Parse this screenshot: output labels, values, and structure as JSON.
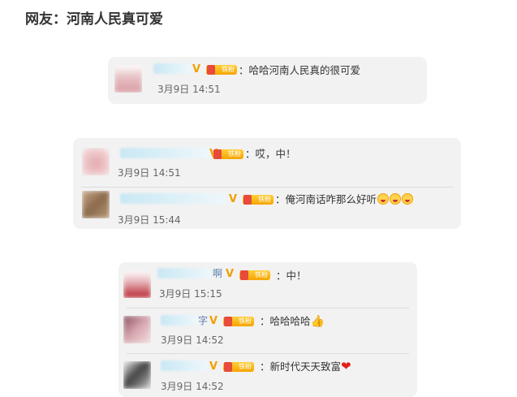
{
  "headline": "网友：河南人民真可爱",
  "badges": {
    "v": "V",
    "fan": "铁粉"
  },
  "cards": [
    {
      "comments": [
        {
          "text": "：哈哈河南人民真的很可爱",
          "time": "3月9日 14:51",
          "avatar_color": "#d9a8ad"
        }
      ]
    },
    {
      "comments": [
        {
          "text": "：哎，中！",
          "time": "3月9日 14:51",
          "avatar_color": "#e6b5b9"
        },
        {
          "text": "：俺河南话咋那么好听",
          "time": "3月9日 15:44",
          "avatar_color": "#9c7a5c",
          "emoji_count": 3
        }
      ]
    },
    {
      "comments": [
        {
          "name_visible": "啊",
          "text": "：中！",
          "time": "3月9日 15:15",
          "avatar_color": "#c0303a"
        },
        {
          "name_visible": "字",
          "text": "：哈哈哈哈",
          "time": "3月9日 14:52",
          "avatar_color": "#a0707a",
          "emoji": "👍"
        },
        {
          "text": "：新时代天天致富",
          "time": "3月9日 14:52",
          "avatar_color": "#555555",
          "emoji": "❤"
        }
      ]
    }
  ]
}
